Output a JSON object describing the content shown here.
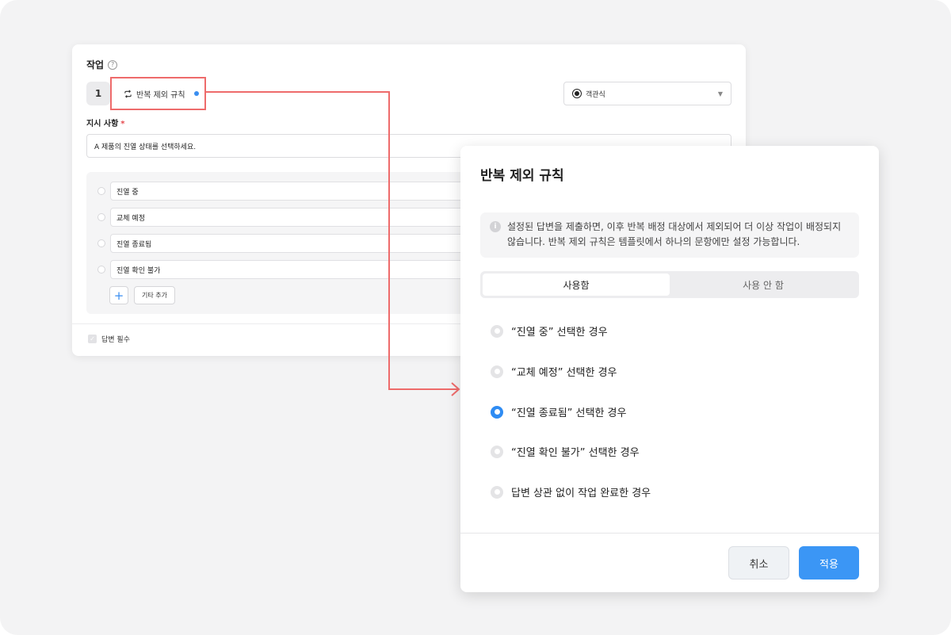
{
  "task": {
    "title": "작업",
    "number": "1",
    "rule_chip_label": "반복 제외 규칙",
    "answer_type": "객관식",
    "instruction_label": "지시 사항",
    "instruction_required_mark": "*",
    "instruction_value": "A 제품의 진열 상태를 선택하세요.",
    "options": [
      "진열 중",
      "교체 예정",
      "진열 종료됨",
      "진열 확인 불가"
    ],
    "add_other_label": "기타 추가",
    "answer_required_label": "답변 필수"
  },
  "modal": {
    "title": "반복 제외 규칙",
    "notice": "설정된 답변을 제출하면, 이후 반복 배정 대상에서 제외되어 더 이상 작업이 배정되지 않습니다. 반복 제외 규칙은 템플릿에서 하나의 문항에만 설정 가능합니다.",
    "tabs": [
      {
        "label": "사용함",
        "active": true
      },
      {
        "label": "사용 안 함",
        "active": false
      }
    ],
    "choices": [
      {
        "label": "“진열 중” 선택한 경우",
        "selected": false
      },
      {
        "label": "“교체 예정” 선택한 경우",
        "selected": false
      },
      {
        "label": "“진열 종료됨” 선택한 경우",
        "selected": true
      },
      {
        "label": "“진열 확인 불가” 선택한 경우",
        "selected": false
      },
      {
        "label": "답변 상관 없이 작업 완료한 경우",
        "selected": false
      }
    ],
    "cancel_label": "취소",
    "apply_label": "적용"
  },
  "colors": {
    "accent": "#3b96f5",
    "highlight": "#ee6b6b"
  }
}
